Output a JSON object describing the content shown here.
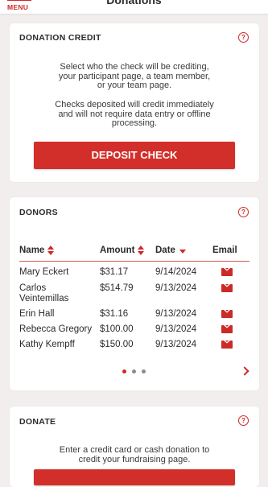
{
  "header": {
    "menu_label": "MENU",
    "title": "Donations"
  },
  "donation_credit": {
    "title": "DONATION CREDIT",
    "help": "?",
    "desc_lines": [
      "Select who the check will be crediting,",
      "your participant page, a team member,",
      "or your team page."
    ],
    "desc2_lines": [
      "Checks deposited will credit immediately",
      "and will not require data entry or offline",
      "processing."
    ],
    "button": "DEPOSIT CHECK"
  },
  "donors": {
    "title": "DONORS",
    "help": "?",
    "columns": [
      "Name",
      "Amount",
      "Date",
      "Email"
    ],
    "rows": [
      {
        "name": "Mary Eckert",
        "amount": "$31.17",
        "date": "9/14/2024"
      },
      {
        "name": "Carlos Veintemillas",
        "amount": "$514.79",
        "date": "9/13/2024"
      },
      {
        "name": "Erin Hall",
        "amount": "$31.16",
        "date": "9/13/2024"
      },
      {
        "name": "Rebecca Gregory",
        "amount": "$100.00",
        "date": "9/13/2024"
      },
      {
        "name": "Kathy Kempff",
        "amount": "$150.00",
        "date": "9/13/2024"
      }
    ],
    "pager": {
      "pages": 3,
      "current": 1
    }
  },
  "donate": {
    "title": "DONATE",
    "help": "?",
    "desc_lines": [
      "Enter a credit card or cash donation to",
      "credit your fundraising page."
    ]
  },
  "colors": {
    "accent": "#cc2a27",
    "background": "#f1eeed",
    "card": "#ffffff"
  },
  "icons": {
    "help": "question-circle-icon",
    "email": "envelope-icon",
    "next": "chevron-right-icon",
    "sort": "sort-arrows-icon"
  }
}
